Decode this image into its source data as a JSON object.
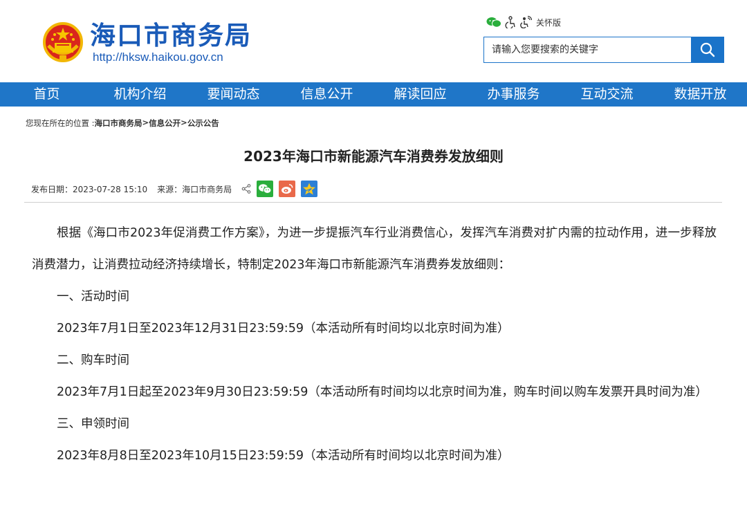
{
  "header": {
    "site_name": "海口市商务局",
    "site_url": "http://hksw.haikou.gov.cn",
    "care_label": "关怀版",
    "search_placeholder": "请输入您要搜索的关键字"
  },
  "nav": {
    "items": [
      "首页",
      "机构介绍",
      "要闻动态",
      "信息公开",
      "解读回应",
      "办事服务",
      "互动交流",
      "数据开放"
    ]
  },
  "breadcrumb": {
    "prefix": "您现在所在的位置 :",
    "items": [
      "海口市商务局",
      "信息公开",
      "公示公告"
    ],
    "separator": ">"
  },
  "article": {
    "title": "2023年海口市新能源汽车消费券发放细则",
    "publish_date": "发布日期：2023-07-28 15:10",
    "source": "来源：海口市商务局",
    "paragraphs": [
      "根据《海口市2023年促消费工作方案》，为进一步提振汽车行业消费信心，发挥汽车消费对扩内需的拉动作用，进一步释放消费潜力，让消费拉动经济持续增长，特制定2023年海口市新能源汽车消费券发放细则：",
      "一、活动时间",
      "2023年7月1日至2023年12月31日23:59:59（本活动所有时间均以北京时间为准）",
      "二、购车时间",
      "2023年7月1日起至2023年9月30日23:59:59（本活动所有时间均以北京时间为准，购车时间以购车发票开具时间为准）",
      "三、申领时间",
      "2023年8月8日至2023年10月15日23:59:59（本活动所有时间均以北京时间为准）"
    ]
  },
  "colors": {
    "brand_blue": "#1a5bb8",
    "nav_blue": "#1f76c8",
    "wechat_green": "#2aae3c",
    "weibo_orange": "#e9694a",
    "qzone_blue": "#2b7fd6"
  }
}
